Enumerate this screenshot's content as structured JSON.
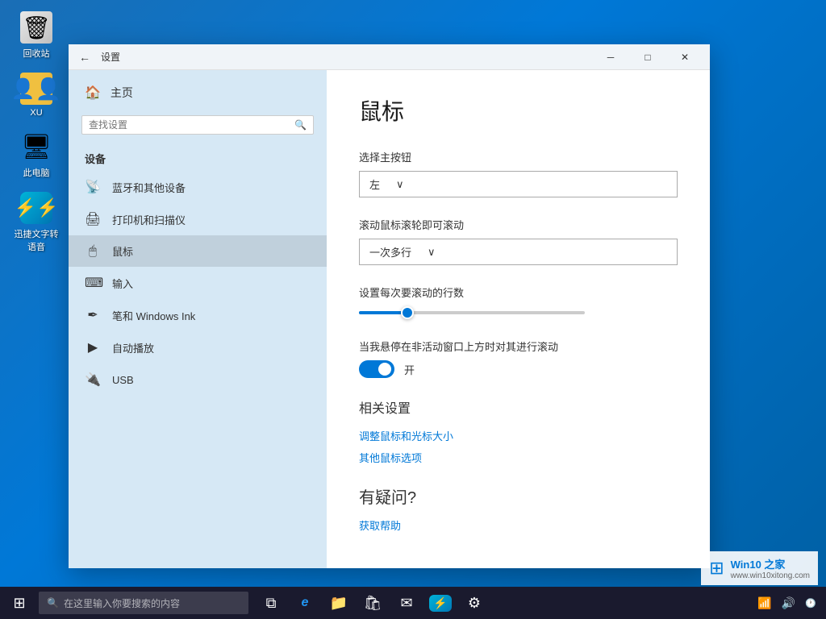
{
  "window": {
    "title": "设置",
    "back_icon": "←",
    "minimize_icon": "─",
    "maximize_icon": "□",
    "close_icon": "✕"
  },
  "desktop_icons": [
    {
      "id": "recycle-bin",
      "label": "回收站",
      "icon": "🗑"
    },
    {
      "id": "user",
      "label": "XU",
      "icon": "👤"
    },
    {
      "id": "computer",
      "label": "此电脑",
      "icon": "🖥"
    },
    {
      "id": "app",
      "label": "迅捷文字转语音",
      "icon": "⚡"
    }
  ],
  "sidebar": {
    "home_icon": "🏠",
    "home_label": "主页",
    "search_placeholder": "查找设置",
    "section_title": "设备",
    "items": [
      {
        "id": "bluetooth",
        "icon": "📡",
        "label": "蓝牙和其他设备"
      },
      {
        "id": "printer",
        "icon": "🖨",
        "label": "打印机和扫描仪"
      },
      {
        "id": "mouse",
        "icon": "🖱",
        "label": "鼠标",
        "active": true
      },
      {
        "id": "input",
        "icon": "⌨",
        "label": "输入"
      },
      {
        "id": "pen",
        "icon": "✒",
        "label": "笔和 Windows Ink"
      },
      {
        "id": "autoplay",
        "icon": "▶",
        "label": "自动播放"
      },
      {
        "id": "usb",
        "icon": "🔌",
        "label": "USB"
      }
    ]
  },
  "content": {
    "page_title": "鼠标",
    "primary_button_label": "选择主按钮",
    "primary_button_value": "左",
    "primary_button_dropdown_arrow": "∨",
    "scroll_label": "滚动鼠标滚轮即可滚动",
    "scroll_value": "一次多行",
    "scroll_dropdown_arrow": "∨",
    "lines_label": "设置每次要滚动的行数",
    "inactive_label": "当我悬停在非活动窗口上方时对其进行滚动",
    "toggle_state": "开",
    "related_title": "相关设置",
    "link1": "调整鼠标和光标大小",
    "link2": "其他鼠标选项",
    "help_title": "有疑问?",
    "help_link": "获取帮助"
  },
  "taskbar": {
    "start_icon": "⊞",
    "search_placeholder": "在这里输入你要搜索的内容",
    "search_icon": "🔍",
    "task_view_icon": "⧉",
    "edge_icon": "e",
    "explorer_icon": "📁",
    "store_icon": "🛍",
    "mail_icon": "✉",
    "app_icon": "⚡",
    "settings_icon": "⚙"
  },
  "watermark": {
    "logo": "⊞",
    "title": "Win10 之家",
    "url": "www.win10xitong.com"
  }
}
